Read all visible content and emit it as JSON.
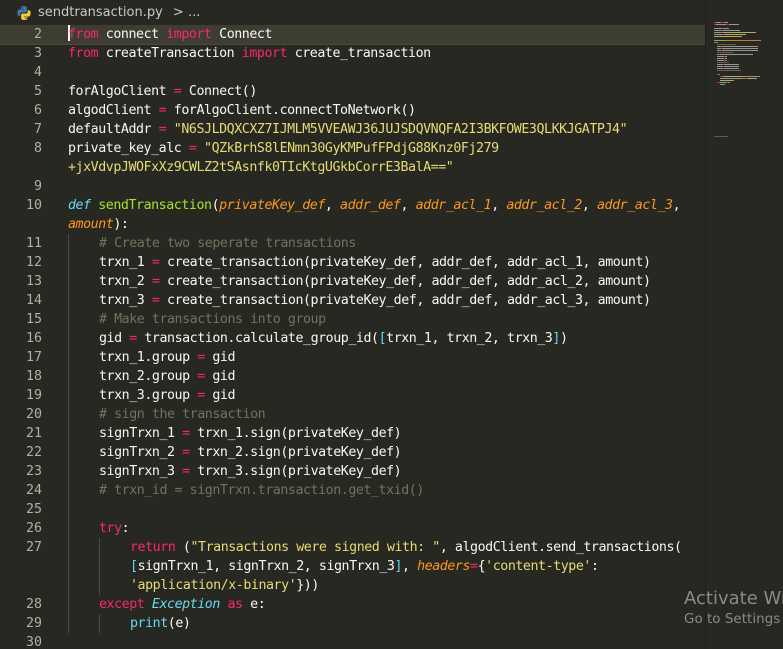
{
  "breadcrumb": {
    "file_name": "sendtransaction.py",
    "separator": " > ...",
    "file_icon": "python-icon"
  },
  "editor": {
    "theme": {
      "background": "#272822",
      "keyword": "#f92672",
      "function": "#a6e22e",
      "string": "#e6db74",
      "comment": "#75715e",
      "parameter": "#fd971f",
      "builtin": "#66d9ef"
    },
    "lines": [
      {
        "num": "2",
        "current": true,
        "indent": 0,
        "tokens": [
          [
            "k",
            "from"
          ],
          [
            "n",
            " connect "
          ],
          [
            "k",
            "import"
          ],
          [
            "n",
            " Connect"
          ]
        ]
      },
      {
        "num": "3",
        "indent": 0,
        "tokens": [
          [
            "k",
            "from"
          ],
          [
            "n",
            " createTransaction "
          ],
          [
            "k",
            "import"
          ],
          [
            "n",
            " create_transaction"
          ]
        ]
      },
      {
        "num": "4",
        "indent": 0,
        "tokens": []
      },
      {
        "num": "5",
        "indent": 0,
        "tokens": [
          [
            "n",
            "forAlgoClient "
          ],
          [
            "o",
            "="
          ],
          [
            "n",
            " Connect()"
          ]
        ]
      },
      {
        "num": "6",
        "indent": 0,
        "tokens": [
          [
            "n",
            "algodClient "
          ],
          [
            "o",
            "="
          ],
          [
            "n",
            " forAlgoClient.connectToNetwork()"
          ]
        ]
      },
      {
        "num": "7",
        "indent": 0,
        "tokens": [
          [
            "n",
            "defaultAddr "
          ],
          [
            "o",
            "="
          ],
          [
            "n",
            " "
          ],
          [
            "s",
            "\"N6SJLDQXCXZ7IJMLM5VVEAWJ36JUJSDQVNQFA2I3BKFOWE3QLKKJGATPJ4\""
          ]
        ]
      },
      {
        "num": "8",
        "indent": 0,
        "tokens": [
          [
            "n",
            "private_key_alc "
          ],
          [
            "o",
            "="
          ],
          [
            "n",
            " "
          ],
          [
            "s",
            "\"QZkBrhS8lENmn30GyKMPufFPdjG88Knz0Fj279"
          ]
        ]
      },
      {
        "num": "",
        "indent": 0,
        "tokens": [
          [
            "s",
            "+jxVdvpJWOFxXz9CWLZ2tSAsnfk0TIcKtgUGkbCorrE3BalA==\""
          ]
        ]
      },
      {
        "num": "9",
        "indent": 0,
        "tokens": []
      },
      {
        "num": "10",
        "indent": 0,
        "tokens": [
          [
            "t",
            "def"
          ],
          [
            "n",
            " "
          ],
          [
            "f",
            "sendTransaction"
          ],
          [
            "n",
            "("
          ],
          [
            "p",
            "privateKey_def"
          ],
          [
            "n",
            ", "
          ],
          [
            "p",
            "addr_def"
          ],
          [
            "n",
            ", "
          ],
          [
            "p",
            "addr_acl_1"
          ],
          [
            "n",
            ", "
          ],
          [
            "p",
            "addr_acl_2"
          ],
          [
            "n",
            ", "
          ],
          [
            "p",
            "addr_acl_3"
          ],
          [
            "n",
            ","
          ]
        ]
      },
      {
        "num": "",
        "indent": 0,
        "tokens": [
          [
            "p",
            "amount"
          ],
          [
            "n",
            "):"
          ]
        ]
      },
      {
        "num": "11",
        "indent": 1,
        "tokens": [
          [
            "c",
            "# Create two seperate transactions"
          ]
        ]
      },
      {
        "num": "12",
        "indent": 1,
        "tokens": [
          [
            "n",
            "trxn_1 "
          ],
          [
            "o",
            "="
          ],
          [
            "n",
            " create_transaction(privateKey_def, addr_def, addr_acl_1, amount)"
          ]
        ]
      },
      {
        "num": "13",
        "indent": 1,
        "tokens": [
          [
            "n",
            "trxn_2 "
          ],
          [
            "o",
            "="
          ],
          [
            "n",
            " create_transaction(privateKey_def, addr_def, addr_acl_2, amount)"
          ]
        ]
      },
      {
        "num": "14",
        "indent": 1,
        "tokens": [
          [
            "n",
            "trxn_3 "
          ],
          [
            "o",
            "="
          ],
          [
            "n",
            " create_transaction(privateKey_def, addr_def, addr_acl_3, amount)"
          ]
        ]
      },
      {
        "num": "15",
        "indent": 1,
        "tokens": [
          [
            "c",
            "# Make transactions into group"
          ]
        ]
      },
      {
        "num": "16",
        "indent": 1,
        "tokens": [
          [
            "n",
            "gid "
          ],
          [
            "o",
            "="
          ],
          [
            "n",
            " transaction.calculate_group_id("
          ],
          [
            "b",
            "["
          ],
          [
            "n",
            "trxn_1, trxn_2, trxn_3"
          ],
          [
            "b",
            "]"
          ],
          [
            "n",
            ")"
          ]
        ]
      },
      {
        "num": "17",
        "indent": 1,
        "tokens": [
          [
            "n",
            "trxn_1.group "
          ],
          [
            "o",
            "="
          ],
          [
            "n",
            " gid"
          ]
        ]
      },
      {
        "num": "18",
        "indent": 1,
        "tokens": [
          [
            "n",
            "trxn_2.group "
          ],
          [
            "o",
            "="
          ],
          [
            "n",
            " gid"
          ]
        ]
      },
      {
        "num": "19",
        "indent": 1,
        "tokens": [
          [
            "n",
            "trxn_3.group "
          ],
          [
            "o",
            "="
          ],
          [
            "n",
            " gid"
          ]
        ]
      },
      {
        "num": "20",
        "indent": 1,
        "tokens": [
          [
            "c",
            "# sign the transaction"
          ]
        ]
      },
      {
        "num": "21",
        "indent": 1,
        "tokens": [
          [
            "n",
            "signTrxn_1 "
          ],
          [
            "o",
            "="
          ],
          [
            "n",
            " trxn_1.sign(privateKey_def)"
          ]
        ]
      },
      {
        "num": "22",
        "indent": 1,
        "tokens": [
          [
            "n",
            "signTrxn_2 "
          ],
          [
            "o",
            "="
          ],
          [
            "n",
            " trxn_2.sign(privateKey_def)"
          ]
        ]
      },
      {
        "num": "23",
        "indent": 1,
        "tokens": [
          [
            "n",
            "signTrxn_3 "
          ],
          [
            "o",
            "="
          ],
          [
            "n",
            " trxn_3.sign(privateKey_def)"
          ]
        ]
      },
      {
        "num": "24",
        "indent": 1,
        "tokens": [
          [
            "c",
            "# trxn_id = signTrxn.transaction.get_txid()"
          ]
        ]
      },
      {
        "num": "25",
        "indent": 1,
        "tokens": []
      },
      {
        "num": "26",
        "indent": 1,
        "tokens": [
          [
            "k",
            "try"
          ],
          [
            "n",
            ":"
          ]
        ]
      },
      {
        "num": "27",
        "indent": 2,
        "tokens": [
          [
            "k",
            "return"
          ],
          [
            "n",
            " ("
          ],
          [
            "s",
            "\"Transactions were signed with: \""
          ],
          [
            "n",
            ", algodClient.send_transactions("
          ]
        ]
      },
      {
        "num": "",
        "indent": 2,
        "tokens": [
          [
            "b",
            "["
          ],
          [
            "n",
            "signTrxn_1, signTrxn_2, signTrxn_3"
          ],
          [
            "b",
            "]"
          ],
          [
            "n",
            ", "
          ],
          [
            "p",
            "headers"
          ],
          [
            "o",
            "="
          ],
          [
            "n",
            "{"
          ],
          [
            "s",
            "'content-type'"
          ],
          [
            "n",
            ":"
          ]
        ]
      },
      {
        "num": "",
        "indent": 2,
        "tokens": [
          [
            "s",
            "'application/x-binary'"
          ],
          [
            "n",
            "})"
          ],
          [
            "n",
            ")"
          ]
        ]
      },
      {
        "num": "28",
        "indent": 1,
        "tokens": [
          [
            "k",
            "except"
          ],
          [
            "n",
            " "
          ],
          [
            "t",
            "Exception"
          ],
          [
            "n",
            " "
          ],
          [
            "k",
            "as"
          ],
          [
            "n",
            " e:"
          ]
        ]
      },
      {
        "num": "29",
        "indent": 2,
        "tokens": [
          [
            "b",
            "print"
          ],
          [
            "n",
            "(e)"
          ]
        ]
      },
      {
        "num": "30",
        "indent": 0,
        "tokens": []
      }
    ]
  },
  "watermark": {
    "title": "Activate Windows",
    "subtitle": "Go to Settings to activate Windows."
  }
}
